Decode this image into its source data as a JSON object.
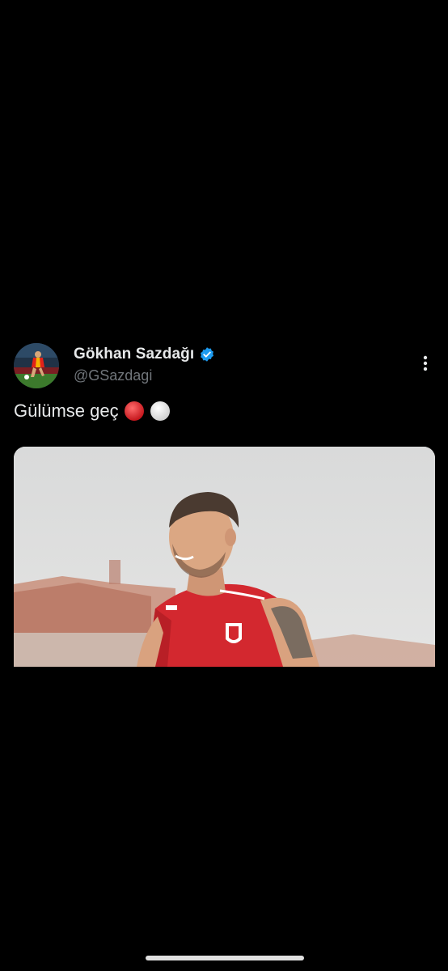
{
  "tweet": {
    "display_name": "Gökhan Sazdağı",
    "handle": "@GSazdagi",
    "verified": true,
    "text": "Gülümse geç",
    "emojis": [
      "red-circle",
      "white-circle"
    ],
    "more_icon": "more-vertical-icon"
  },
  "colors": {
    "background": "#000000",
    "text_primary": "#e7e9ea",
    "text_secondary": "#71767b",
    "verified_blue": "#1d9bf0",
    "jersey_red": "#d3282f"
  }
}
